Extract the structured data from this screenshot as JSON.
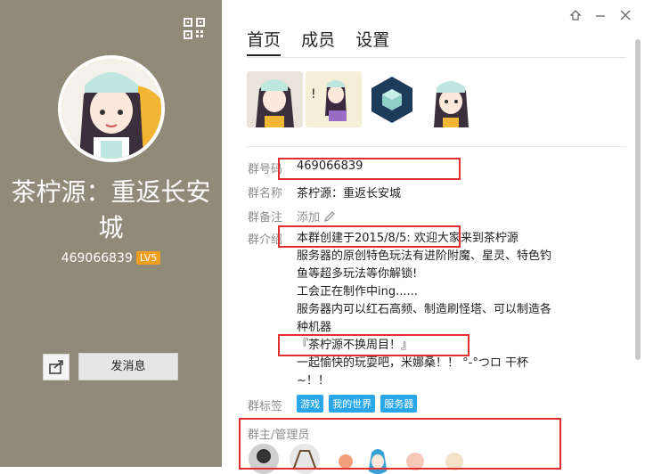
{
  "left_panel": {
    "group_name": "茶柠源：重返长安城",
    "group_id": "469066839",
    "level_badge": "LV5",
    "send_message_label": "发消息"
  },
  "tabs": [
    {
      "label": "首页"
    },
    {
      "label": "成员"
    },
    {
      "label": "设置"
    }
  ],
  "info": {
    "group_number_label": "群号码",
    "group_number": "469066839",
    "group_name_label": "群名称",
    "group_name": "茶柠源：重返长安城",
    "remark_label": "群备注",
    "remark_action": "添加",
    "intro_label": "群介绍",
    "intro_lines": [
      "本群创建于2015/8/5: 欢迎大家来到茶柠源",
      "服务器的原创特色玩法有进阶附魔、星灵、特色钓",
      "鱼等超多玩法等你解锁!",
      "工会正在制作中ing......",
      "服务器内可以红石高频、制造刷怪塔、可以制造各",
      "种机器",
      "『茶柠源不换周目！』",
      "一起愉快的玩耍吧，米娜桑！！ °-°つロ 干杯",
      "~！！"
    ],
    "tags_label": "群标签",
    "tags": [
      "游戏",
      "我的世界",
      "服务器"
    ],
    "admins_label": "群主/管理员"
  },
  "colors": {
    "left_bg": "#8f8b78",
    "tag_bg": "#2aa7e8",
    "badge_bg": "#f0a020",
    "annotation_red": "#e03030"
  }
}
